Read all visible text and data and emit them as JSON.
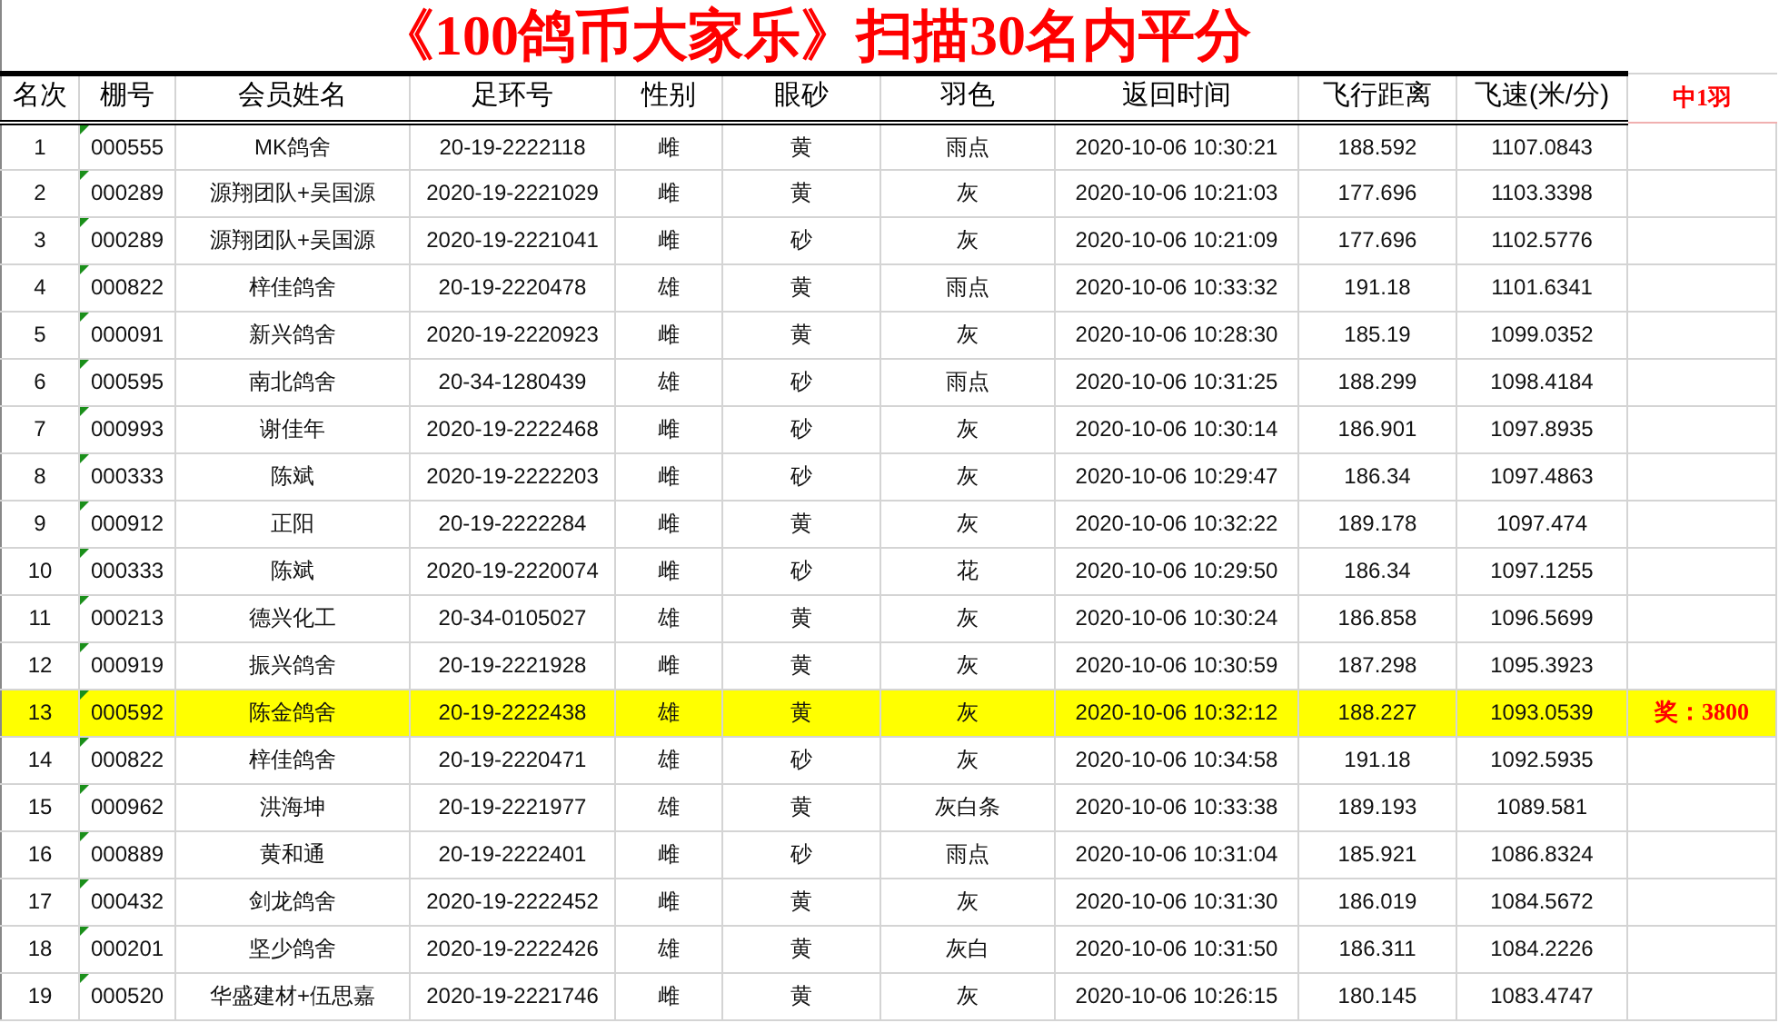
{
  "title": "《100鸽币大家乐》扫描30名内平分",
  "columns": [
    "名次",
    "棚号",
    "会员姓名",
    "足环号",
    "性别",
    "眼砂",
    "羽色",
    "返回时间",
    "飞行距离",
    "飞速(米/分)"
  ],
  "side_note": "中1羽",
  "rows": [
    {
      "cells": [
        "1",
        "000555",
        "MK鸽舍",
        "20-19-2222118",
        "雌",
        "黄",
        "雨点",
        "2020-10-06 10:30:21",
        "188.592",
        "1107.0843"
      ],
      "highlighted": false
    },
    {
      "cells": [
        "2",
        "000289",
        "源翔团队+吴国源",
        "2020-19-2221029",
        "雌",
        "黄",
        "灰",
        "2020-10-06 10:21:03",
        "177.696",
        "1103.3398"
      ],
      "highlighted": false
    },
    {
      "cells": [
        "3",
        "000289",
        "源翔团队+吴国源",
        "2020-19-2221041",
        "雌",
        "砂",
        "灰",
        "2020-10-06 10:21:09",
        "177.696",
        "1102.5776"
      ],
      "highlighted": false
    },
    {
      "cells": [
        "4",
        "000822",
        "梓佳鸽舍",
        "20-19-2220478",
        "雄",
        "黄",
        "雨点",
        "2020-10-06 10:33:32",
        "191.18",
        "1101.6341"
      ],
      "highlighted": false
    },
    {
      "cells": [
        "5",
        "000091",
        "新兴鸽舍",
        "2020-19-2220923",
        "雌",
        "黄",
        "灰",
        "2020-10-06 10:28:30",
        "185.19",
        "1099.0352"
      ],
      "highlighted": false
    },
    {
      "cells": [
        "6",
        "000595",
        "南北鸽舍",
        "20-34-1280439",
        "雄",
        "砂",
        "雨点",
        "2020-10-06 10:31:25",
        "188.299",
        "1098.4184"
      ],
      "highlighted": false
    },
    {
      "cells": [
        "7",
        "000993",
        "谢佳年",
        "2020-19-2222468",
        "雌",
        "砂",
        "灰",
        "2020-10-06 10:30:14",
        "186.901",
        "1097.8935"
      ],
      "highlighted": false
    },
    {
      "cells": [
        "8",
        "000333",
        "陈斌",
        "2020-19-2222203",
        "雌",
        "砂",
        "灰",
        "2020-10-06 10:29:47",
        "186.34",
        "1097.4863"
      ],
      "highlighted": false
    },
    {
      "cells": [
        "9",
        "000912",
        "正阳",
        "20-19-2222284",
        "雌",
        "黄",
        "灰",
        "2020-10-06 10:32:22",
        "189.178",
        "1097.474"
      ],
      "highlighted": false
    },
    {
      "cells": [
        "10",
        "000333",
        "陈斌",
        "2020-19-2220074",
        "雌",
        "砂",
        "花",
        "2020-10-06 10:29:50",
        "186.34",
        "1097.1255"
      ],
      "highlighted": false
    },
    {
      "cells": [
        "11",
        "000213",
        "德兴化工",
        "20-34-0105027",
        "雄",
        "黄",
        "灰",
        "2020-10-06 10:30:24",
        "186.858",
        "1096.5699"
      ],
      "highlighted": false
    },
    {
      "cells": [
        "12",
        "000919",
        "振兴鸽舍",
        "20-19-2221928",
        "雌",
        "黄",
        "灰",
        "2020-10-06 10:30:59",
        "187.298",
        "1095.3923"
      ],
      "highlighted": false
    },
    {
      "cells": [
        "13",
        "000592",
        "陈金鸽舍",
        "20-19-2222438",
        "雄",
        "黄",
        "灰",
        "2020-10-06 10:32:12",
        "188.227",
        "1093.0539"
      ],
      "highlighted": true,
      "prize": "奖：3800"
    },
    {
      "cells": [
        "14",
        "000822",
        "梓佳鸽舍",
        "20-19-2220471",
        "雄",
        "砂",
        "灰",
        "2020-10-06 10:34:58",
        "191.18",
        "1092.5935"
      ],
      "highlighted": false
    },
    {
      "cells": [
        "15",
        "000962",
        "洪海坤",
        "20-19-2221977",
        "雄",
        "黄",
        "灰白条",
        "2020-10-06 10:33:38",
        "189.193",
        "1089.581"
      ],
      "highlighted": false
    },
    {
      "cells": [
        "16",
        "000889",
        "黄和通",
        "20-19-2222401",
        "雌",
        "砂",
        "雨点",
        "2020-10-06 10:31:04",
        "185.921",
        "1086.8324"
      ],
      "highlighted": false
    },
    {
      "cells": [
        "17",
        "000432",
        "剑龙鸽舍",
        "2020-19-2222452",
        "雌",
        "黄",
        "灰",
        "2020-10-06 10:31:30",
        "186.019",
        "1084.5672"
      ],
      "highlighted": false
    },
    {
      "cells": [
        "18",
        "000201",
        "坚少鸽舍",
        "2020-19-2222426",
        "雄",
        "黄",
        "灰白",
        "2020-10-06 10:31:50",
        "186.311",
        "1084.2226"
      ],
      "highlighted": false
    },
    {
      "cells": [
        "19",
        "000520",
        "华盛建材+伍思嘉",
        "2020-19-2221746",
        "雌",
        "黄",
        "灰",
        "2020-10-06 10:26:15",
        "180.145",
        "1083.4747"
      ],
      "highlighted": false
    }
  ]
}
